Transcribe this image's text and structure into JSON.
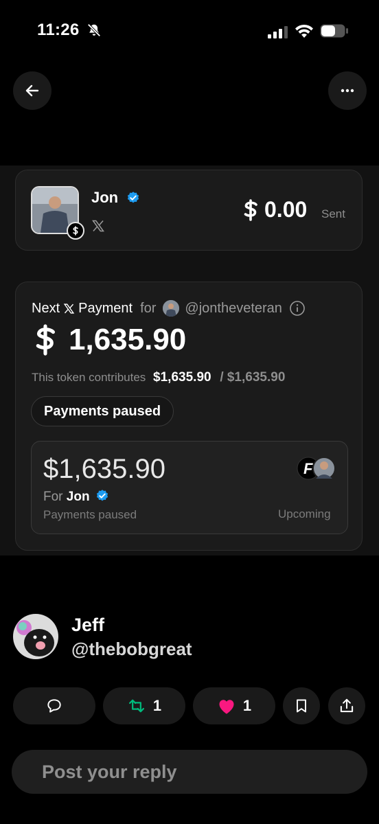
{
  "status_bar": {
    "time": "11:26"
  },
  "payment_card": {
    "name": "Jon",
    "sent_amount": "0.00",
    "sent_label": "Sent"
  },
  "next_payment": {
    "label_next": "Next",
    "label_payment": "Payment",
    "label_for": "for",
    "handle": "@jontheveteran",
    "amount": "1,635.90",
    "contrib_label": "This token contributes",
    "contrib_value": "$1,635.90",
    "contrib_total": "/ $1,635.90",
    "paused_pill": "Payments paused",
    "inner_amount": "$1,635.90",
    "inner_for": "For",
    "inner_name": "Jon",
    "inner_status": "Payments paused",
    "inner_upcoming": "Upcoming"
  },
  "reply_author": {
    "name": "Jeff",
    "handle": "@thebobgreat"
  },
  "actions": {
    "retweets": "1",
    "likes": "1"
  },
  "reply_box": {
    "placeholder": "Post your reply"
  },
  "colors": {
    "verified": "#1d9bf0",
    "retweet": "#00ba7c",
    "like": "#f91880"
  }
}
